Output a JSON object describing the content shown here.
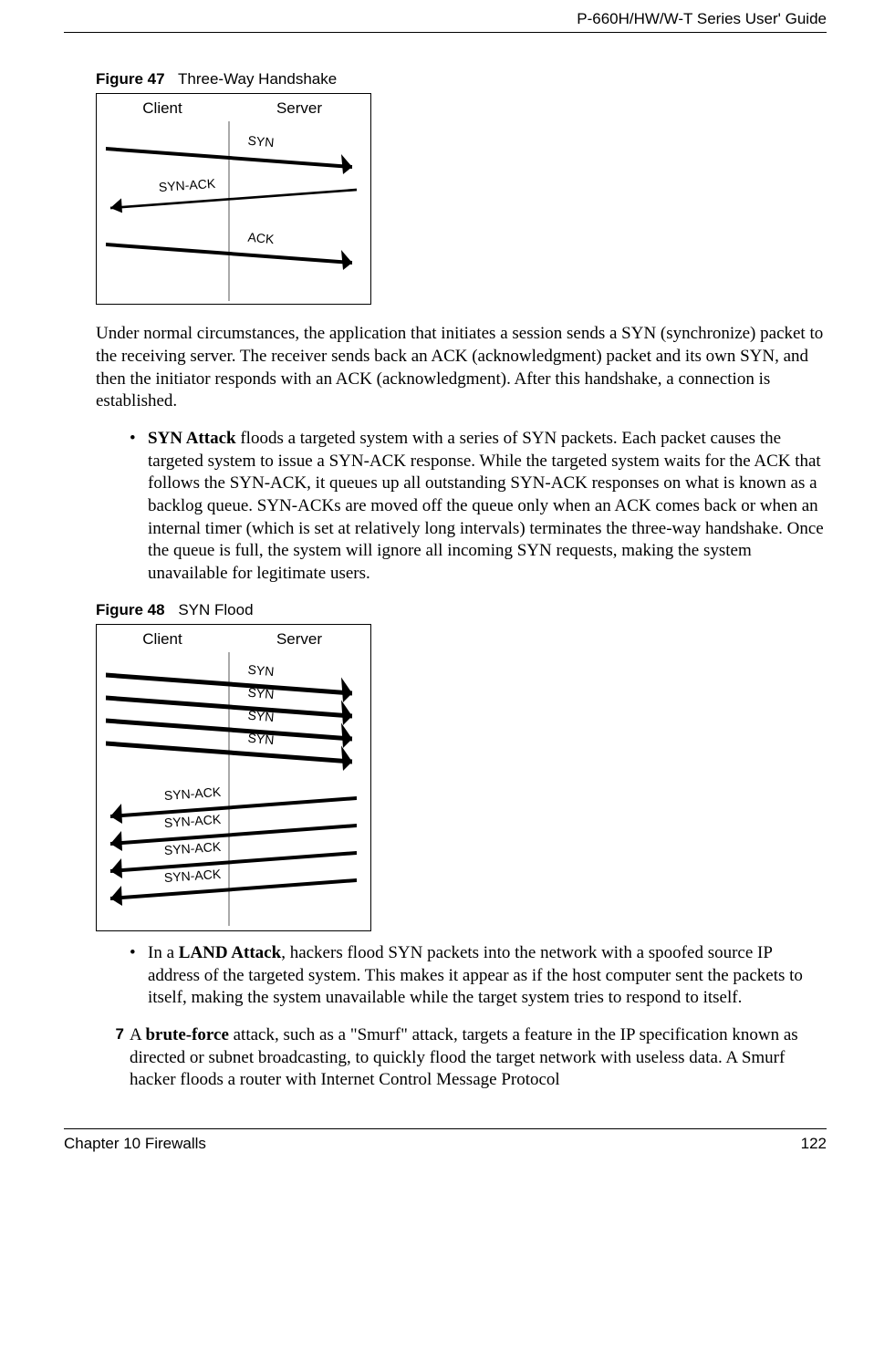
{
  "header": {
    "guide_title": "P-660H/HW/W-T Series User' Guide"
  },
  "figures": {
    "f47": {
      "label": "Figure 47",
      "title": "Three-Way Handshake",
      "client": "Client",
      "server": "Server",
      "lbl_syn": "SYN",
      "lbl_synack": "SYN-ACK",
      "lbl_ack": "ACK"
    },
    "f48": {
      "label": "Figure 48",
      "title": "SYN Flood",
      "client": "Client",
      "server": "Server",
      "lbl_syn": "SYN",
      "lbl_synack": "SYN-ACK"
    }
  },
  "text": {
    "para1": "Under normal circumstances, the application that initiates a session sends a SYN (synchronize) packet to the receiving server. The receiver sends back an ACK (acknowledgment) packet and its own SYN, and then the initiator responds with an ACK (acknowledgment). After this handshake, a connection is established.",
    "syn_bold": "SYN Attack",
    "syn_rest": " floods a targeted system with a series of SYN packets. Each packet causes the targeted system to issue a SYN-ACK response. While the targeted system waits for the ACK that follows the SYN-ACK, it queues up all outstanding SYN-ACK responses on what is known as a backlog queue. SYN-ACKs are moved off the queue only when an ACK comes back or when an internal timer (which is set at relatively long intervals) terminates the three-way handshake. Once the queue is full, the system will ignore all incoming SYN requests, making the system unavailable for legitimate users.",
    "land_pre": "In a ",
    "land_bold": "LAND Attack",
    "land_rest": ", hackers flood SYN packets into the network with a spoofed source IP address of the targeted system. This makes it appear as if the host computer sent the packets to itself, making the system unavailable while the target system tries to respond to itself.",
    "num7": "7",
    "brute_pre": "A ",
    "brute_bold": "brute-force",
    "brute_rest": " attack, such as a \"Smurf\" attack, targets a feature in the IP specification known as directed or subnet broadcasting, to quickly flood the target network with useless data. A Smurf hacker floods a router with Internet Control Message Protocol"
  },
  "footer": {
    "chapter": "Chapter 10 Firewalls",
    "page": "122"
  }
}
